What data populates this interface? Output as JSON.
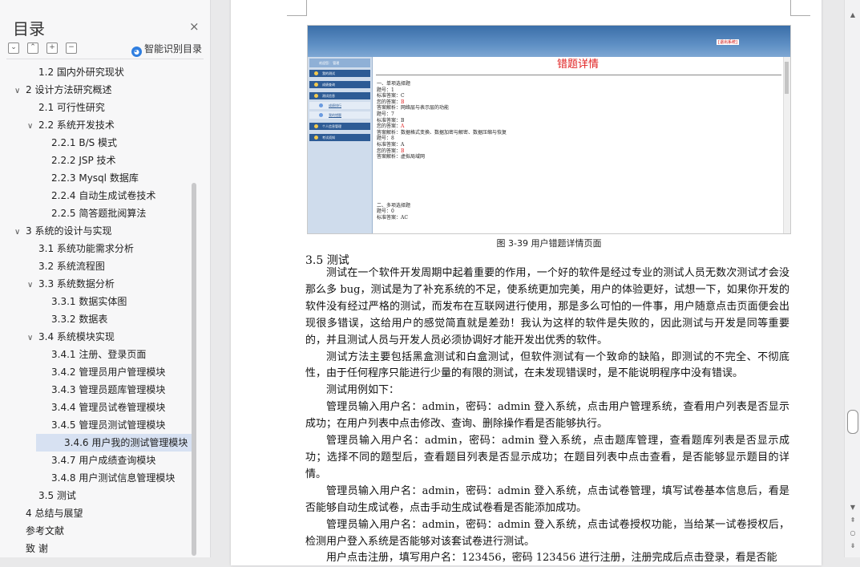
{
  "toc": {
    "title": "目录",
    "close": "×",
    "buttons": [
      "⌄",
      "⌃",
      "+",
      "−"
    ],
    "smart_label": "智能识别目录",
    "items": [
      {
        "label": "1.2  国内外研究现状",
        "level": 2,
        "chevron": ""
      },
      {
        "label": "2  设计方法研究概述",
        "level": 1,
        "chevron": "∨"
      },
      {
        "label": "2.1  可行性研究",
        "level": 2,
        "chevron": ""
      },
      {
        "label": "2.2  系统开发技术",
        "level": 2,
        "chevron": "∨"
      },
      {
        "label": "2.2.1    B/S 模式",
        "level": 3,
        "chevron": ""
      },
      {
        "label": "2.2.2 JSP 技术",
        "level": 3,
        "chevron": ""
      },
      {
        "label": "2.2.3 Mysql 数据库",
        "level": 3,
        "chevron": ""
      },
      {
        "label": "2.2.4  自动生成试卷技术",
        "level": 3,
        "chevron": ""
      },
      {
        "label": "2.2.5   简答题批阅算法",
        "level": 3,
        "chevron": ""
      },
      {
        "label": "3  系统的设计与实现",
        "level": 1,
        "chevron": "∨"
      },
      {
        "label": "3.1  系统功能需求分析",
        "level": 2,
        "chevron": ""
      },
      {
        "label": "3.2  系统流程图",
        "level": 2,
        "chevron": ""
      },
      {
        "label": "3.3  系统数据分析",
        "level": 2,
        "chevron": "∨"
      },
      {
        "label": "3.3.1     数据实体图",
        "level": 3,
        "chevron": ""
      },
      {
        "label": "3.3.2     数据表",
        "level": 3,
        "chevron": ""
      },
      {
        "label": "3.4  系统模块实现",
        "level": 2,
        "chevron": "∨"
      },
      {
        "label": "3.4.1  注册、登录页面",
        "level": 3,
        "chevron": ""
      },
      {
        "label": "3.4.2  管理员用户管理模块",
        "level": 3,
        "chevron": ""
      },
      {
        "label": "3.4.3  管理员题库管理模块",
        "level": 3,
        "chevron": ""
      },
      {
        "label": "3.4.4  管理员试卷管理模块",
        "level": 3,
        "chevron": ""
      },
      {
        "label": "3.4.5  管理员测试管理模块",
        "level": 3,
        "chevron": ""
      },
      {
        "label": "3.4.6 用户我的测试管理模块",
        "level": 3,
        "chevron": "",
        "selected": true
      },
      {
        "label": "3.4.7 用户成绩查询模块",
        "level": 3,
        "chevron": ""
      },
      {
        "label": "3.4.8 用户测试信息管理模块",
        "level": 3,
        "chevron": ""
      },
      {
        "label": "3.5  测试",
        "level": 2,
        "chevron": ""
      },
      {
        "label": "4  总结与展望",
        "level": 1,
        "chevron": ""
      },
      {
        "label": "参考文献",
        "level": 1,
        "chevron": ""
      },
      {
        "label": "致    谢",
        "level": 1,
        "chevron": ""
      }
    ]
  },
  "screenshot": {
    "logout": "[退出系统]",
    "user": "欢迎您：   管理",
    "nav": [
      {
        "label": "我的测试",
        "style": "dark"
      },
      {
        "label": "成绩查询",
        "style": "dark"
      },
      {
        "label": "测试信息",
        "style": "dark"
      },
      {
        "label": "成绩排行",
        "style": "light"
      },
      {
        "label": "我的错题",
        "style": "light"
      },
      {
        "label": "个人信息管理",
        "style": "dark"
      },
      {
        "label": "考试须知",
        "style": "dark"
      }
    ],
    "title": "错题详情",
    "lines": [
      {
        "text": "一、单项选择题",
        "red": ""
      },
      {
        "text": "题号：1",
        "red": ""
      },
      {
        "text": "标准答案：C",
        "red": ""
      },
      {
        "text": "您的答案：",
        "red": "B"
      },
      {
        "text": "答案解析：网络层与表示层的功能",
        "red": ""
      },
      {
        "text": "题号：7",
        "red": ""
      },
      {
        "text": "标准答案：B",
        "red": ""
      },
      {
        "text": "您的答案：",
        "red": "A"
      },
      {
        "text": "答案解析：数据格式变换、数据加密与解密、数据压缩与恢复",
        "red": ""
      },
      {
        "text": "题号：8",
        "red": ""
      },
      {
        "text": "标准答案：A",
        "red": ""
      },
      {
        "text": "您的答案：",
        "red": "B"
      },
      {
        "text": "答案解析：虚拟局域网",
        "red": ""
      }
    ],
    "lines2": [
      {
        "text": "二、多项选择题",
        "red": ""
      },
      {
        "text": "题号：0",
        "red": ""
      },
      {
        "text": "标准答案：AC",
        "red": ""
      }
    ]
  },
  "caption": "图 3-39 用户错题详情页面",
  "section_heading": "3.5  测试",
  "paragraphs": [
    "测试在一个软件开发周期中起着重要的作用，一个好的软件是经过专业的测试人员无数次测试才会没那么多 bug，测试是为了补充系统的不足，使系统更加完美，用户的体验更好，试想一下，如果你开发的软件没有经过严格的测试，而发布在互联网进行使用，那是多么可怕的一件事，用户随意点击页面便会出现很多错误，这给用户的感觉简直就是差劲！我认为这样的软件是失败的，因此测试与开发是同等重要的，并且测试人员与开发人员必须协调好才能开发出优秀的软件。",
    "测试方法主要包括黑盒测试和白盒测试，但软件测试有一个致命的缺陷，即测试的不完全、不彻底性，由于任何程序只能进行少量的有限的测试，在未发现错误时，是不能说明程序中没有错误。",
    "测试用例如下：",
    "管理员输入用户名：admin，密码：admin 登入系统，点击用户管理系统，查看用户列表是否显示成功；在用户列表中点击修改、查询、删除操作看是否能够执行。",
    "管理员输入用户名：admin，密码：admin 登入系统，点击题库管理，查看题库列表是否显示成功；选择不同的题型后，查看题目列表是否显示成功；在题目列表中点击查看，是否能够显示题目的详情。",
    "管理员输入用户名：admin，密码：admin 登入系统，点击试卷管理，填写试卷基本信息后，看是否能够自动生成试卷，点击手动生成试卷看是否能添加成功。",
    "管理员输入用户名：admin，密码：admin 登入系统，点击试卷授权功能，当给某一试卷授权后，检测用户登入系统是否能够对该套试卷进行测试。",
    "用户点击注册，填写用户名：123456，密码 123456 进行注册，注册完成后点击登录，看是否能"
  ]
}
